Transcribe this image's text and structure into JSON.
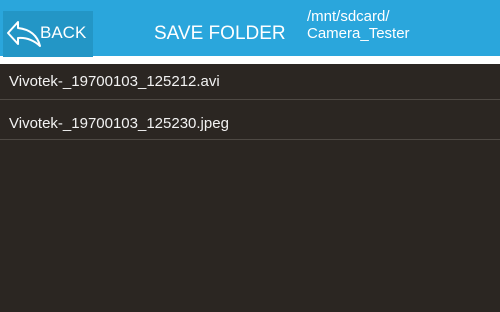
{
  "header": {
    "back_label": "BACK",
    "title": "SAVE FOLDER",
    "path_line1": "/mnt/sdcard/",
    "path_line2": "Camera_Tester"
  },
  "files": [
    {
      "name": "Vivotek-_19700103_125212.avi"
    },
    {
      "name": "Vivotek-_19700103_125230.jpeg"
    }
  ],
  "colors": {
    "header_bg": "#2aa6dc",
    "back_button_bg": "#2396c6",
    "list_bg": "#2b2622",
    "divider": "#4e4944",
    "text": "#ffffff"
  },
  "icons": {
    "back": "back-arrow-icon"
  }
}
